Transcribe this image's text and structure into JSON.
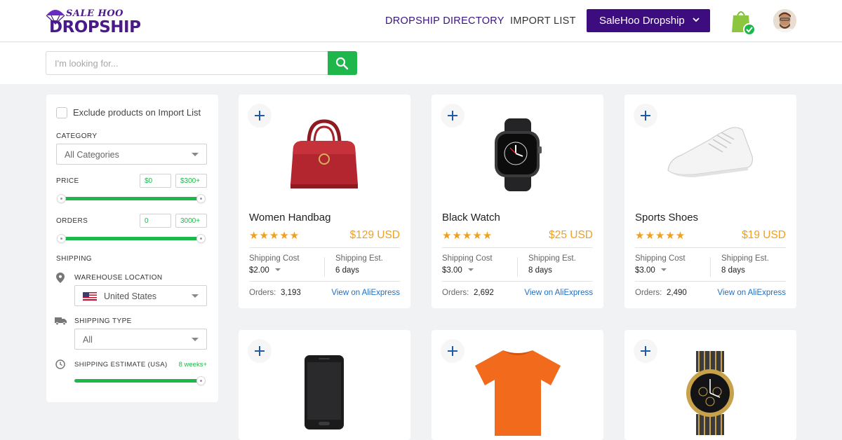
{
  "brand": {
    "logo_top": "SALE HOO",
    "logo_bottom": "DROPSHIP"
  },
  "nav": {
    "directory": "DROPSHIP DIRECTORY",
    "import_list": "IMPORT LIST",
    "account_button": "SaleHoo Dropship"
  },
  "search": {
    "placeholder": "I'm looking for..."
  },
  "colors": {
    "brand_purple": "#3d0d7f",
    "accent_green": "#1fb64b",
    "price_orange": "#f0a020",
    "link_blue": "#1e6fc4"
  },
  "filters": {
    "exclude_label": "Exclude products on Import List",
    "category": {
      "label": "CATEGORY",
      "value": "All Categories"
    },
    "price": {
      "label": "PRICE",
      "min": "$0",
      "max": "$300+"
    },
    "orders": {
      "label": "ORDERS",
      "min": "0",
      "max": "3000+"
    },
    "shipping": {
      "label": "SHIPPING",
      "warehouse_label": "WAREHOUSE LOCATION",
      "warehouse_value": "United States",
      "type_label": "SHIPPING TYPE",
      "type_value": "All",
      "estimate_label": "SHIPPING ESTIMATE (USA)",
      "estimate_value": "8 weeks+"
    }
  },
  "card_labels": {
    "shipping_cost": "Shipping Cost",
    "shipping_est": "Shipping Est.",
    "orders": "Orders:",
    "view_link": "View on AliExpress"
  },
  "products": [
    {
      "name": "Women Handbag",
      "rating": "★★★★★",
      "price": "$129 USD",
      "shipping_cost": "$2.00",
      "shipping_est": "6 days",
      "orders": "3,193"
    },
    {
      "name": "Black Watch",
      "rating": "★★★★★",
      "price": "$25 USD",
      "shipping_cost": "$3.00",
      "shipping_est": "8 days",
      "orders": "2,692"
    },
    {
      "name": "Sports Shoes",
      "rating": "★★★★★",
      "price": "$19 USD",
      "shipping_cost": "$3.00",
      "shipping_est": "8 days",
      "orders": "2,490"
    }
  ]
}
